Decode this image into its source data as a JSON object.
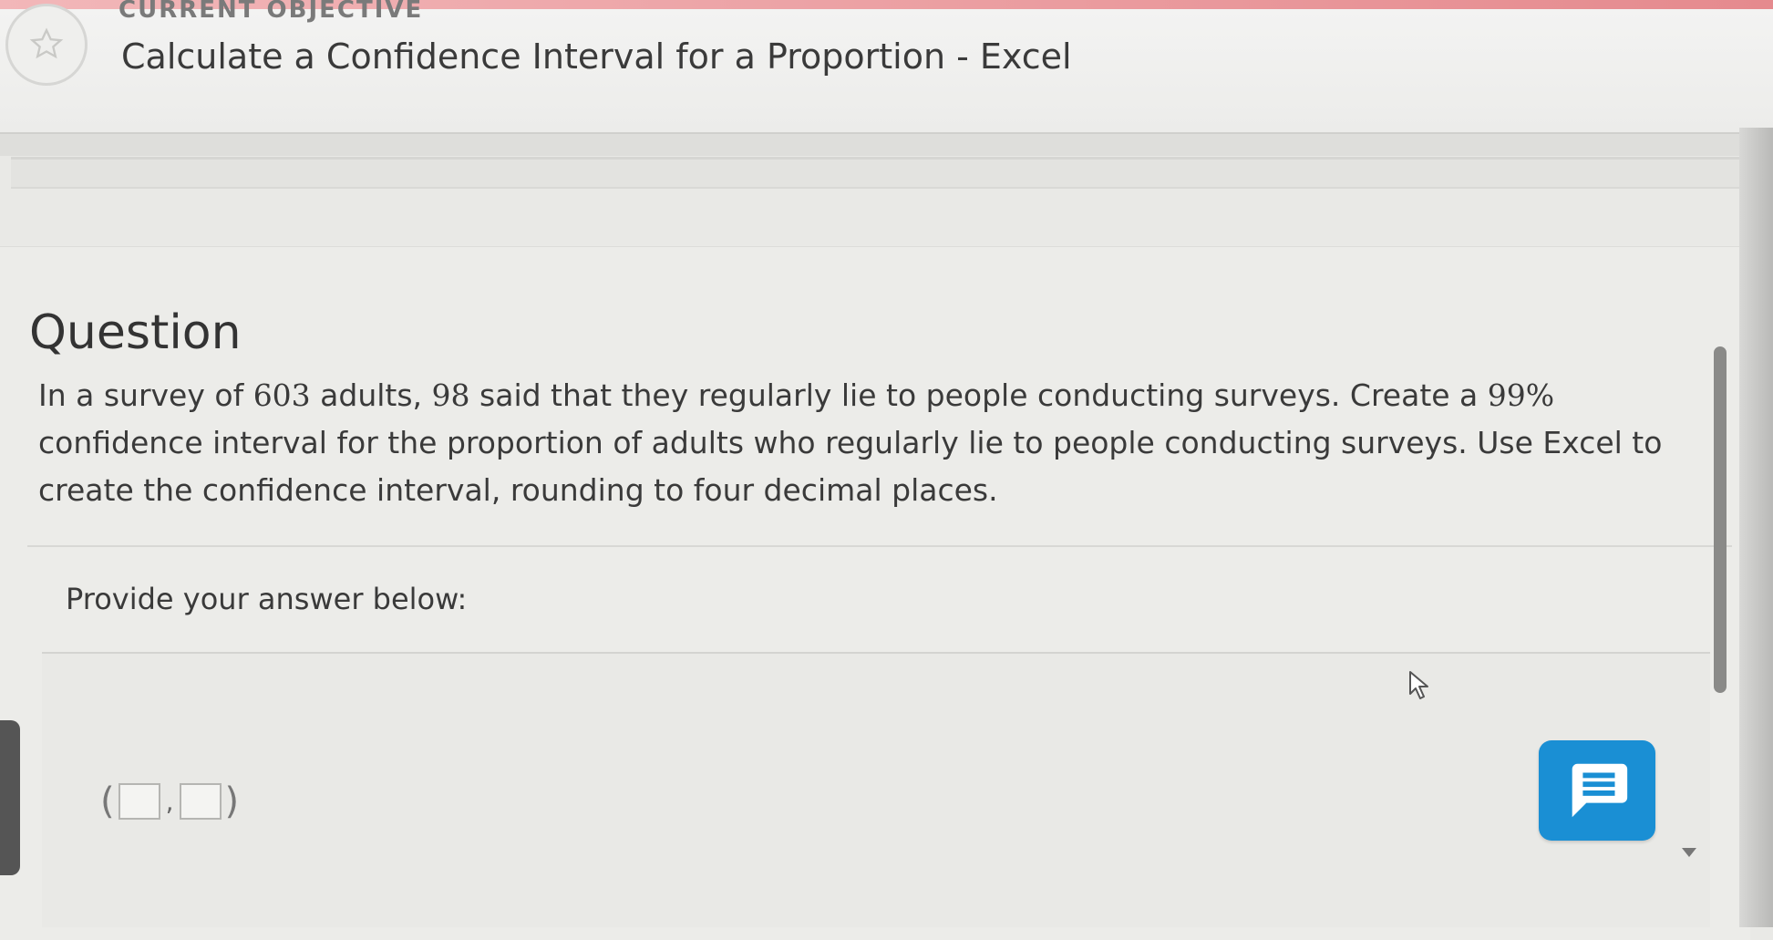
{
  "header": {
    "objective_label": "CURRENT OBJECTIVE",
    "title": "Calculate a Confidence Interval for a Proportion - Excel"
  },
  "question": {
    "heading": "Question",
    "text_parts": {
      "p1": "In a survey of ",
      "n": "603",
      "p2": " adults, ",
      "x": "98",
      "p3": " said that they regularly lie to people conducting surveys. Create a ",
      "conf": "99%",
      "p4": " confidence interval for the proportion of adults who regularly lie to people conducting surveys. Use Excel to create the confidence interval, rounding to four decimal places."
    }
  },
  "answer": {
    "prompt": "Provide your answer below:",
    "open_paren": "(",
    "separator": ",",
    "close_paren": ")",
    "lower_value": "",
    "upper_value": ""
  },
  "icons": {
    "badge": "star-icon",
    "chat": "chat-icon",
    "cursor": "mouse-pointer-icon"
  },
  "colors": {
    "accent": "#e58a8e",
    "chat_button": "#1a8fd4"
  }
}
